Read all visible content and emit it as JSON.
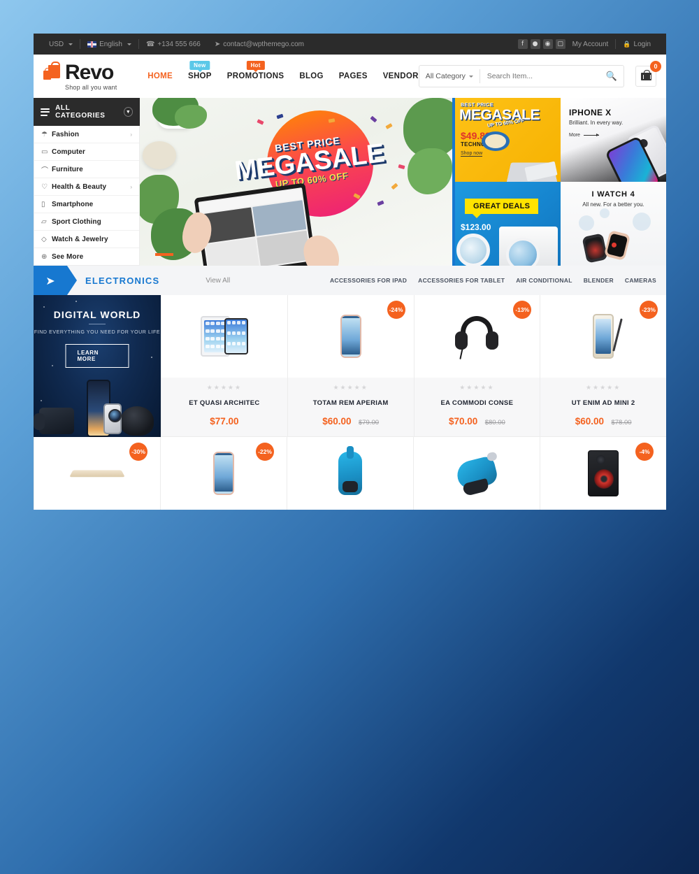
{
  "topbar": {
    "currency": "USD",
    "language": "English",
    "phone": "+134 555 666",
    "email": "contact@wpthemego.com",
    "social": [
      "facebook-icon",
      "twitter-icon",
      "pinterest-icon",
      "instagram-icon"
    ],
    "my_account": "My Account",
    "login": "Login"
  },
  "header": {
    "logo_name": "Revo",
    "logo_tagline": "Shop all you want",
    "nav": [
      {
        "label": "HOME",
        "badge": null,
        "active": true
      },
      {
        "label": "SHOP",
        "badge": "New",
        "badge_type": "new",
        "active": false
      },
      {
        "label": "PROMOTIONS",
        "badge": "Hot",
        "badge_type": "hot",
        "active": false
      },
      {
        "label": "BLOG",
        "badge": null,
        "active": false
      },
      {
        "label": "PAGES",
        "badge": null,
        "active": false
      },
      {
        "label": "VENDOR",
        "badge": null,
        "active": false
      }
    ],
    "search_category": "All Category",
    "search_placeholder": "Search Item...",
    "search_value": "",
    "cart_count": "0"
  },
  "categories": {
    "title": "ALL CATEGORIES",
    "items": [
      {
        "label": "Fashion",
        "icon": "shirt-icon",
        "glyph": "☂",
        "arrow": true
      },
      {
        "label": "Computer",
        "icon": "monitor-icon",
        "glyph": "▭",
        "arrow": false
      },
      {
        "label": "Furniture",
        "icon": "bed-icon",
        "glyph": "⌒",
        "arrow": false
      },
      {
        "label": "Health & Beauty",
        "icon": "heart-icon",
        "glyph": "♡",
        "arrow": true
      },
      {
        "label": "Smartphone",
        "icon": "phone-icon",
        "glyph": "▯",
        "arrow": false
      },
      {
        "label": "Sport Clothing",
        "icon": "shoe-icon",
        "glyph": "▱",
        "arrow": false
      },
      {
        "label": "Watch & Jewelry",
        "icon": "diamond-icon",
        "glyph": "◇",
        "arrow": false
      },
      {
        "label": "See More",
        "icon": "plus-circle-icon",
        "glyph": "⊕",
        "arrow": false
      }
    ]
  },
  "slider": {
    "kicker": "BEST PRICE",
    "headline": "MEGASALE",
    "subline": "UP TO 60% OFF"
  },
  "banners": [
    {
      "name": "megasale-technology",
      "kicker": "BEST PRICE",
      "title": "MEGASALE",
      "ribbon": "UP TO 60% OFF",
      "price": "$49.89",
      "subtitle": "TECHNOLOGY",
      "cta": "Shop now"
    },
    {
      "name": "iphone-x",
      "title": "IPHONE X",
      "subtitle": "Brilliant. In every way.",
      "cta": "More"
    },
    {
      "name": "great-deals",
      "tag": "GREAT DEALS",
      "price": "$123.00"
    },
    {
      "name": "i-watch-4",
      "title": "I WATCH 4",
      "subtitle": "All new. For a better you."
    }
  ],
  "section": {
    "title": "ELECTRONICS",
    "view_all": "View All",
    "subcats": [
      "ACCESSORIES FOR IPAD",
      "ACCESSORIES FOR TABLET",
      "AIR CONDITIONAL",
      "BLENDER",
      "CAMERAS"
    ]
  },
  "promo_banner": {
    "title": "DIGITAL WORLD",
    "subtitle": "FIND EVERYTHING YOU NEED FOR YOUR LIFE",
    "button": "LEARN MORE"
  },
  "products_row1": [
    {
      "name": "ET QUASI ARCHITEC",
      "price": "$77.00",
      "old_price": "",
      "discount": "",
      "rating": "★★★★★",
      "image": "ipad-pair"
    },
    {
      "name": "TOTAM REM APERIAM",
      "price": "$60.00",
      "old_price": "$79.00",
      "discount": "-24%",
      "rating": "★★★★★",
      "image": "rose-gold-iphone"
    },
    {
      "name": "EA COMMODI CONSE",
      "price": "$70.00",
      "old_price": "$80.00",
      "discount": "-13%",
      "rating": "★★★★★",
      "image": "black-headphones"
    },
    {
      "name": "UT ENIM AD MINI 2",
      "price": "$60.00",
      "old_price": "$78.00",
      "discount": "-23%",
      "rating": "★★★★★",
      "image": "gold-note-phone"
    }
  ],
  "products_row2": [
    {
      "discount": "-30%",
      "image": "gold-laptop"
    },
    {
      "discount": "-22%",
      "image": "rose-gold-iphone"
    },
    {
      "discount": "",
      "image": "blue-vacuum-upright"
    },
    {
      "discount": "",
      "image": "blue-vacuum-canister"
    },
    {
      "discount": "-4%",
      "image": "black-party-speaker"
    }
  ],
  "colors": {
    "accent_orange": "#f4621f",
    "accent_blue": "#1778d0",
    "topbar_dark": "#2b2b2b",
    "page_bg_start": "#8ec7ee",
    "page_bg_end": "#0c2651"
  }
}
